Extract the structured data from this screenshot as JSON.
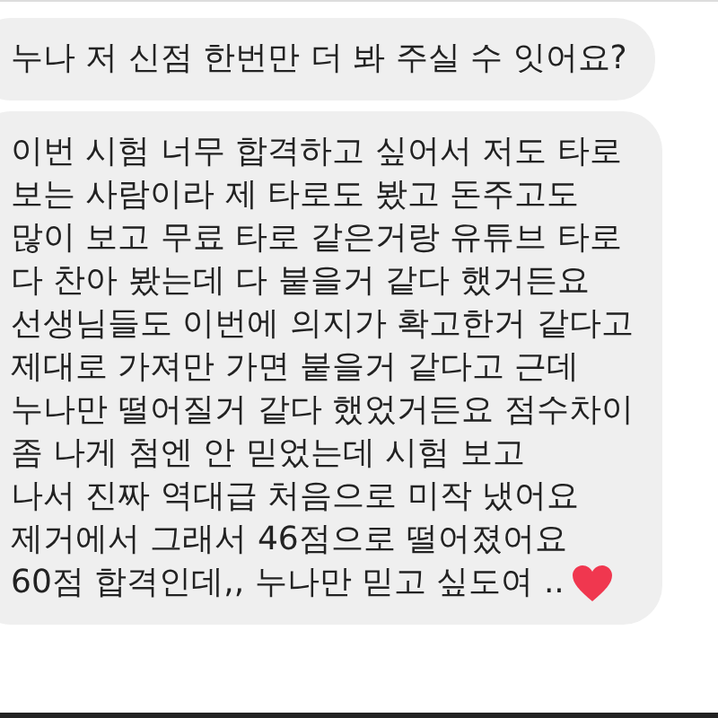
{
  "messages": [
    {
      "lines": [
        "누나 저 신점 한번만 더 봐 주실 수 잇어요?"
      ]
    },
    {
      "lines": [
        "이번 시험 너무 합격하고 싶어서 저도 타로",
        "보는 사람이라 제 타로도 봤고 돈주고도",
        "많이 보고 무료 타로 같은거랑 유튜브 타로",
        "다 찬아 봤는데 다 붙을거 같다 했거든요",
        "선생님들도 이번에 의지가 확고한거 같다고",
        "제대로 가져만 가면 붙을거 같다고 근데",
        "누나만 떨어질거 같다 했었거든요 점수차이",
        "좀 나게 첨엔 안 믿었는데 시험 보고",
        "나서 진짜 역대급 처음으로 미작 냈어요",
        "제거에서 그래서 46점으로 떨어졌어요",
        "60점 합격인데,, 누나만 믿고 싶도여 .."
      ],
      "heart": true
    }
  ]
}
